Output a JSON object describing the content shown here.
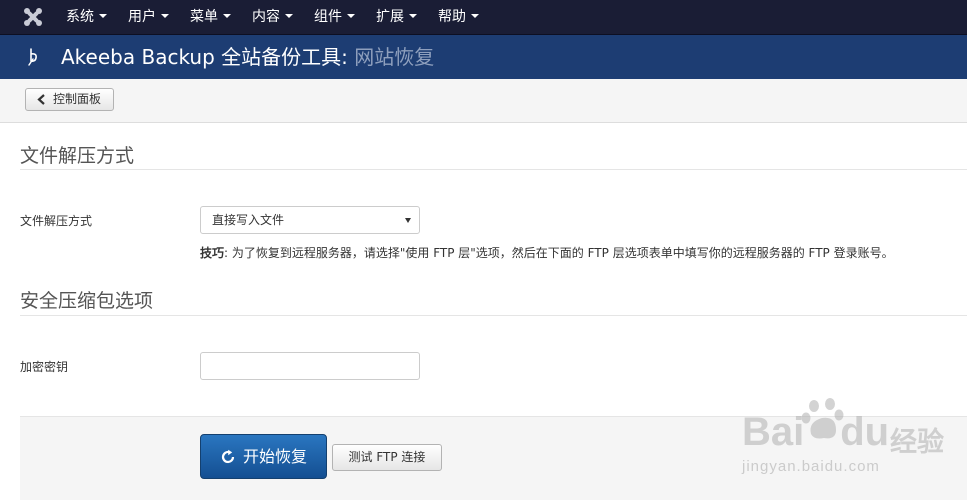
{
  "navbar": {
    "logo_icon": "joomla-logo-icon",
    "menu": [
      {
        "label": "系统"
      },
      {
        "label": "用户"
      },
      {
        "label": "菜单"
      },
      {
        "label": "内容"
      },
      {
        "label": "组件"
      },
      {
        "label": "扩展"
      },
      {
        "label": "帮助"
      }
    ]
  },
  "header": {
    "icon": "akeeba-logo-icon",
    "title": "Akeeba Backup 全站备份工具:",
    "subtitle": "网站恢复"
  },
  "toolbar": {
    "back_label": "控制面板",
    "back_icon": "chevron-left-icon"
  },
  "sections": {
    "extract": {
      "title": "文件解压方式",
      "field_label": "文件解压方式",
      "select_value": "直接写入文件",
      "tip_prefix": "技巧",
      "tip_text": ": 为了恢复到远程服务器，请选择\"使用 FTP 层\"选项，然后在下面的 FTP 层选项表单中填写你的远程服务器的 FTP 登录账号。"
    },
    "security": {
      "title": "安全压缩包选项",
      "field_label": "加密密钥",
      "input_value": ""
    }
  },
  "actions": {
    "start_label": "开始恢复",
    "start_icon": "refresh-icon",
    "test_ftp_label": "测试 FTP 连接"
  },
  "watermark": {
    "brand": "Bai",
    "brand_suffix": "du",
    "jingyan": "经验",
    "url": "jingyan.baidu.com"
  },
  "colors": {
    "navbar_bg": "#1a1d35",
    "header_bg": "#1d3d73",
    "primary_button": "#1f62a8"
  }
}
